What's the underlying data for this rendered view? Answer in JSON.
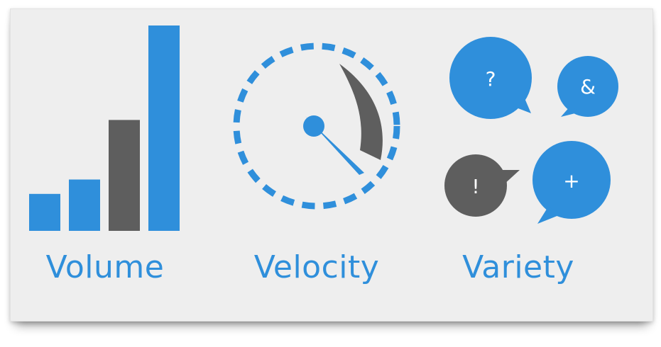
{
  "colors": {
    "blue": "#2f8fdb",
    "gray": "#5e5e5e",
    "background": "#eeeeee",
    "glyph": "#ffffff"
  },
  "panels": [
    {
      "label": "Volume"
    },
    {
      "label": "Velocity"
    },
    {
      "label": "Variety"
    }
  ],
  "volume": {
    "bars": [
      {
        "level": 0.18,
        "color": "blue"
      },
      {
        "level": 0.25,
        "color": "blue"
      },
      {
        "level": 0.54,
        "color": "gray"
      },
      {
        "level": 1.0,
        "color": "blue"
      }
    ]
  },
  "variety": {
    "bubbles": [
      {
        "glyph": "?",
        "color": "blue"
      },
      {
        "glyph": "&",
        "color": "blue"
      },
      {
        "glyph": "!",
        "color": "gray"
      },
      {
        "glyph": "+",
        "color": "blue"
      }
    ]
  }
}
